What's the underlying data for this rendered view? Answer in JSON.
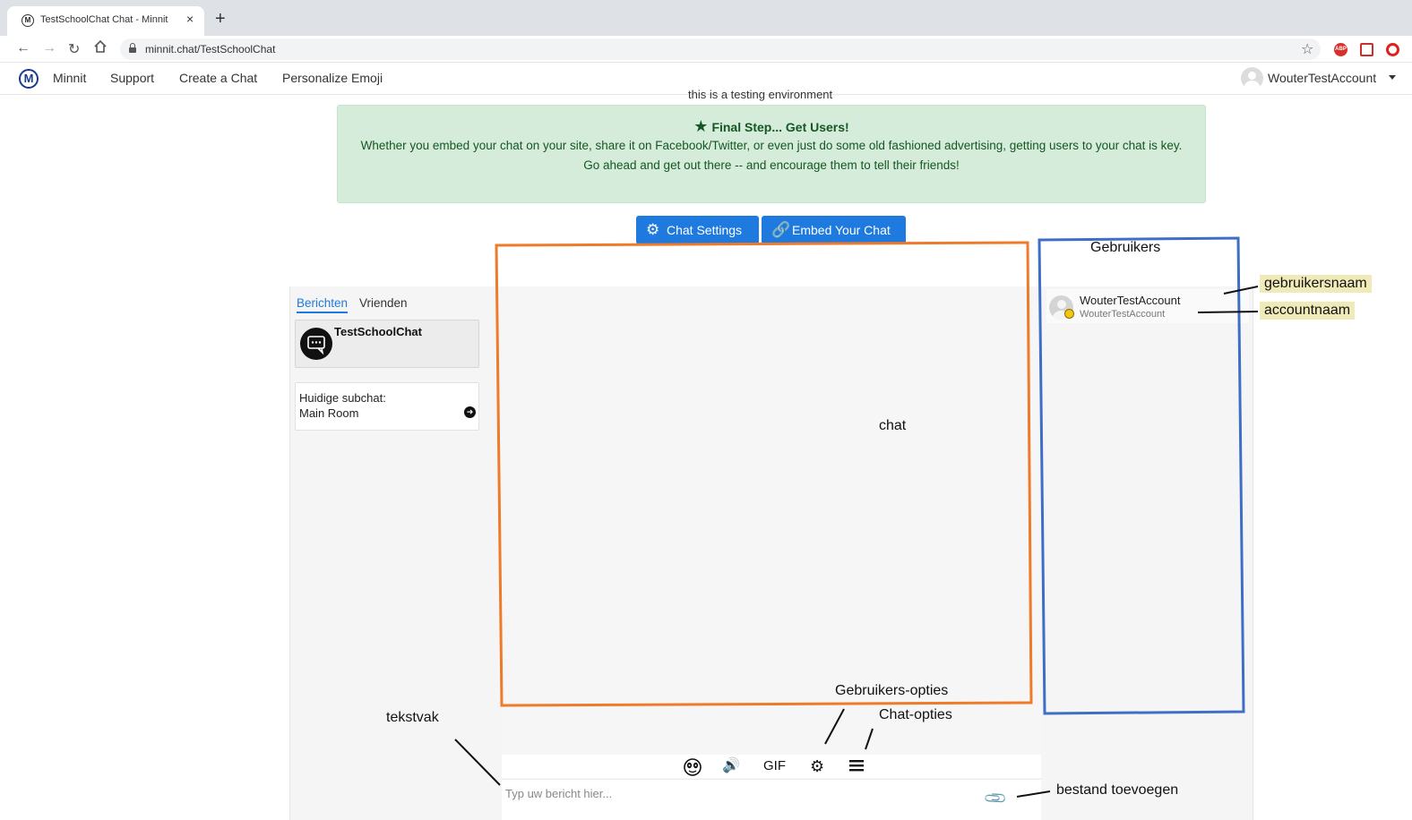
{
  "browser": {
    "tab_title": "TestSchoolChat Chat - Minnit",
    "tab_favicon": "M",
    "new_tab": "+",
    "close_tab": "×",
    "url": "minnit.chat/TestSchoolChat",
    "ext_abp": "ABP"
  },
  "site_nav": {
    "logo_letter": "M",
    "links": [
      "Minnit",
      "Support",
      "Create a Chat",
      "Personalize Emoji"
    ],
    "account_name": "WouterTestAccount"
  },
  "notice": "this is a testing environment",
  "alert": {
    "title": "Final Step... Get Users!",
    "line1": "Whether you embed your chat on your site, share it on Facebook/Twitter, or even just do some old fashioned advertising, getting users to your chat is key.",
    "line2": "Go ahead and get out there -- and encourage them to tell their friends!"
  },
  "buttons": {
    "chat_settings": "Chat Settings",
    "embed_chat": "Embed Your Chat"
  },
  "left_panel": {
    "tabs": [
      "Berichten",
      "Vrienden"
    ],
    "room_name": "TestSchoolChat",
    "subchat_label": "Huidige subchat:",
    "subchat_room": "Main Room"
  },
  "members": [
    {
      "name": "WouterTestAccount",
      "account": "WouterTestAccount",
      "status_color": "#f2c516"
    }
  ],
  "toolbar": {
    "gif": "GIF"
  },
  "composer": {
    "placeholder": "Typ uw bericht hier..."
  },
  "annotations": {
    "chat": "chat",
    "users": "Gebruikers",
    "username": "gebruikersnaam",
    "accountname": "accountnaam",
    "user_options": "Gebruikers-opties",
    "chat_options": "Chat-opties",
    "textbox": "tekstvak",
    "add_file": "bestand toevoegen"
  },
  "colors": {
    "chat_box": "#ef7a2a",
    "users_box": "#3f6fc4",
    "accent": "#1f7ae0",
    "alert_bg": "#d4ecd9"
  }
}
